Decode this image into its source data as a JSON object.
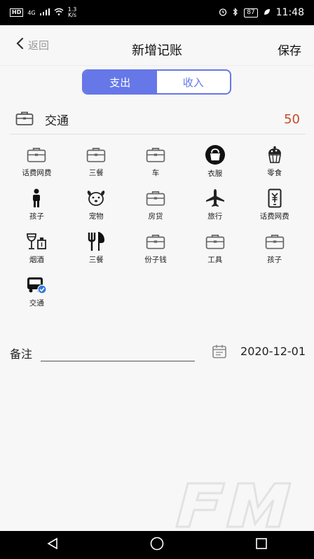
{
  "status_bar": {
    "left": {
      "hd": "HD",
      "network": "4G",
      "speed_value": "1.3",
      "speed_unit": "K/s"
    },
    "right": {
      "battery": "87",
      "time": "11:48"
    }
  },
  "header": {
    "back_label": "返回",
    "title": "新增记账",
    "save_label": "保存"
  },
  "segment": {
    "expense": "支出",
    "income": "收入",
    "active": "expense"
  },
  "selected": {
    "label": "交通",
    "amount": "50"
  },
  "categories": [
    {
      "label": "话费网费",
      "icon": "briefcase-icon"
    },
    {
      "label": "三餐",
      "icon": "briefcase-icon"
    },
    {
      "label": "车",
      "icon": "briefcase-icon"
    },
    {
      "label": "衣服",
      "icon": "bag-icon"
    },
    {
      "label": "零食",
      "icon": "cupcake-icon"
    },
    {
      "label": "孩子",
      "icon": "child-icon"
    },
    {
      "label": "宠物",
      "icon": "dog-icon"
    },
    {
      "label": "房贷",
      "icon": "briefcase-icon"
    },
    {
      "label": "旅行",
      "icon": "airplane-icon"
    },
    {
      "label": "话费网费",
      "icon": "phone-yen-icon"
    },
    {
      "label": "烟酒",
      "icon": "wine-icon"
    },
    {
      "label": "三餐",
      "icon": "fork-knife-icon"
    },
    {
      "label": "份子钱",
      "icon": "briefcase-icon"
    },
    {
      "label": "工具",
      "icon": "briefcase-icon"
    },
    {
      "label": "孩子",
      "icon": "briefcase-icon"
    },
    {
      "label": "交通",
      "icon": "bus-check-icon"
    }
  ],
  "note": {
    "label": "备注",
    "value": ""
  },
  "date": {
    "value": "2020-12-01"
  },
  "colors": {
    "accent": "#6677e8",
    "amount": "#c34b2b"
  }
}
